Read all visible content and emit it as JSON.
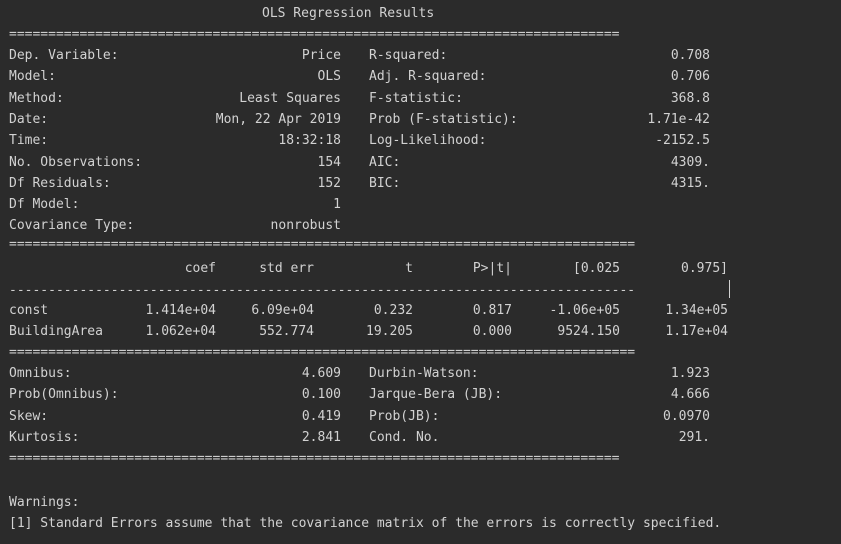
{
  "title": "OLS Regression Results",
  "model_info": [
    {
      "label": "Dep. Variable:",
      "value": "Price",
      "label2": "R-squared:",
      "value2": "0.708"
    },
    {
      "label": "Model:",
      "value": "OLS",
      "label2": "Adj. R-squared:",
      "value2": "0.706"
    },
    {
      "label": "Method:",
      "value": "Least Squares",
      "label2": "F-statistic:",
      "value2": "368.8"
    },
    {
      "label": "Date:",
      "value": "Mon, 22 Apr 2019",
      "label2": "Prob (F-statistic):",
      "value2": "1.71e-42"
    },
    {
      "label": "Time:",
      "value": "18:32:18",
      "label2": "Log-Likelihood:",
      "value2": "-2152.5"
    },
    {
      "label": "No. Observations:",
      "value": "154",
      "label2": "AIC:",
      "value2": "4309."
    },
    {
      "label": "Df Residuals:",
      "value": "152",
      "label2": "BIC:",
      "value2": "4315."
    },
    {
      "label": "Df Model:",
      "value": "1",
      "label2": "",
      "value2": ""
    },
    {
      "label": "Covariance Type:",
      "value": "nonrobust",
      "label2": "",
      "value2": ""
    }
  ],
  "coef_table": {
    "headers": [
      "coef",
      "std err",
      "t",
      "P>|t|",
      "[0.025",
      "0.975]"
    ],
    "rows": [
      {
        "name": "const",
        "values": [
          "1.414e+04",
          "6.09e+04",
          "0.232",
          "0.817",
          "-1.06e+05",
          "1.34e+05"
        ]
      },
      {
        "name": "BuildingArea",
        "values": [
          "1.062e+04",
          "552.774",
          "19.205",
          "0.000",
          "9524.150",
          "1.17e+04"
        ]
      }
    ]
  },
  "diagnostics": [
    {
      "label": "Omnibus:",
      "value": "4.609",
      "label2": "Durbin-Watson:",
      "value2": "1.923"
    },
    {
      "label": "Prob(Omnibus):",
      "value": "0.100",
      "label2": "Jarque-Bera (JB):",
      "value2": "4.666"
    },
    {
      "label": "Skew:",
      "value": "0.419",
      "label2": "Prob(JB):",
      "value2": "0.0970"
    },
    {
      "label": "Kurtosis:",
      "value": "2.841",
      "label2": "Cond. No.",
      "value2": "291."
    }
  ],
  "warnings": {
    "heading": "Warnings:",
    "lines": [
      "[1] Standard Errors assume that the covariance matrix of the errors is correctly specified."
    ]
  }
}
